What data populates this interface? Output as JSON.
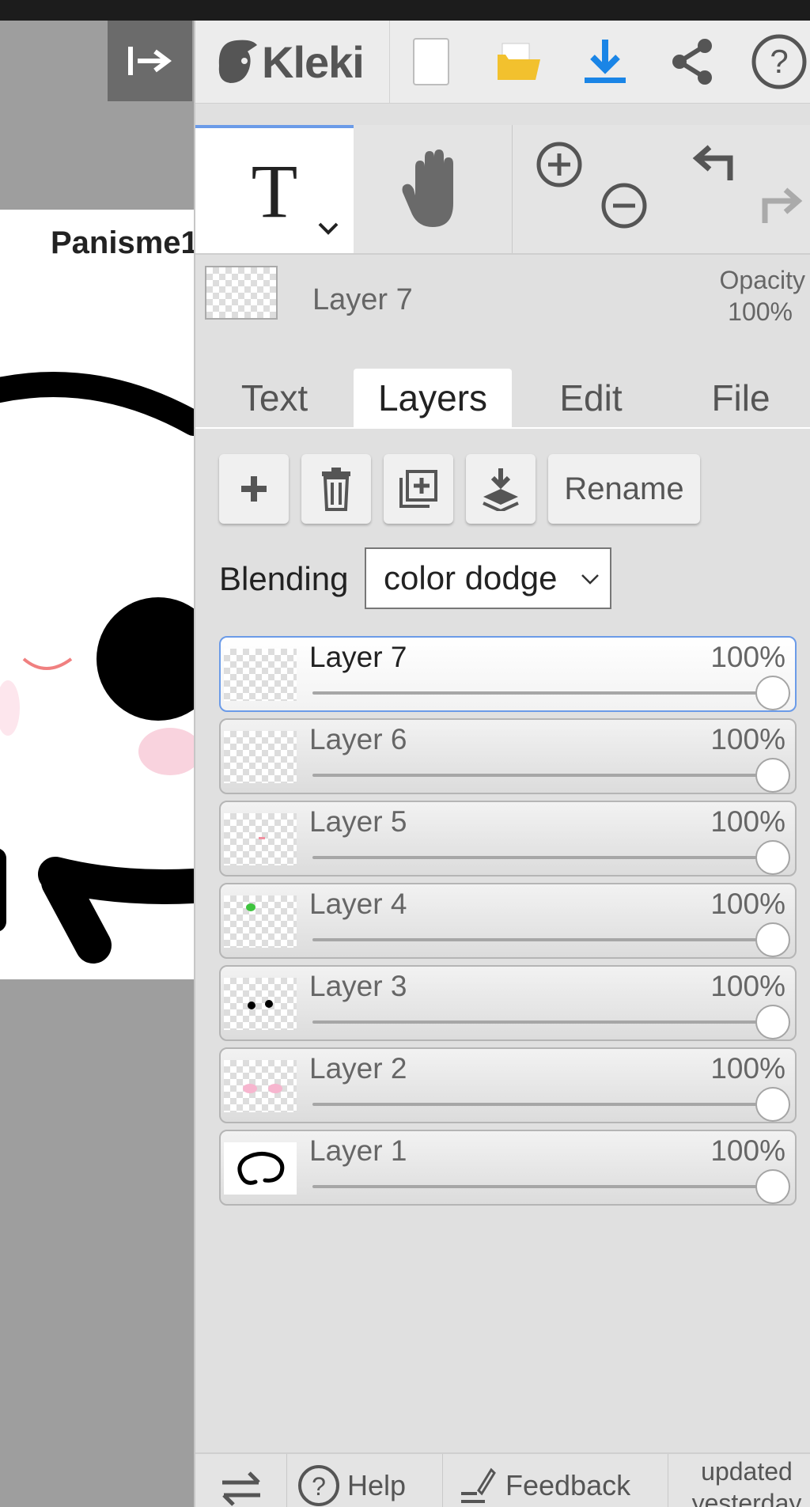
{
  "canvas": {
    "watermark_text": "Panisme1"
  },
  "header": {
    "logo_text": "Kleki"
  },
  "tools": {
    "active_tool_glyph": "T"
  },
  "current_layer": {
    "name": "Layer 7",
    "opacity_label": "Opacity",
    "opacity_value": "100%"
  },
  "tabs": [
    {
      "label": "Text"
    },
    {
      "label": "Layers"
    },
    {
      "label": "Edit"
    },
    {
      "label": "File"
    }
  ],
  "actions": {
    "rename_label": "Rename"
  },
  "blending": {
    "label": "Blending",
    "value": "color dodge"
  },
  "layers": [
    {
      "name": "Layer 7",
      "opacity": "100%",
      "opacity_value": 1.0,
      "selected": true
    },
    {
      "name": "Layer 6",
      "opacity": "100%",
      "opacity_value": 1.0
    },
    {
      "name": "Layer 5",
      "opacity": "100%",
      "opacity_value": 1.0
    },
    {
      "name": "Layer 4",
      "opacity": "100%",
      "opacity_value": 1.0
    },
    {
      "name": "Layer 3",
      "opacity": "100%",
      "opacity_value": 1.0
    },
    {
      "name": "Layer 2",
      "opacity": "100%",
      "opacity_value": 1.0
    },
    {
      "name": "Layer 1",
      "opacity": "100%",
      "opacity_value": 1.0
    }
  ],
  "footer": {
    "help_label": "Help",
    "feedback_label": "Feedback",
    "updated_line1": "updated",
    "updated_line2": "yesterday"
  },
  "colors": {
    "accent": "#6b9be8",
    "download_icon": "#1a85e6",
    "folder_icon": "#f2c12e"
  }
}
